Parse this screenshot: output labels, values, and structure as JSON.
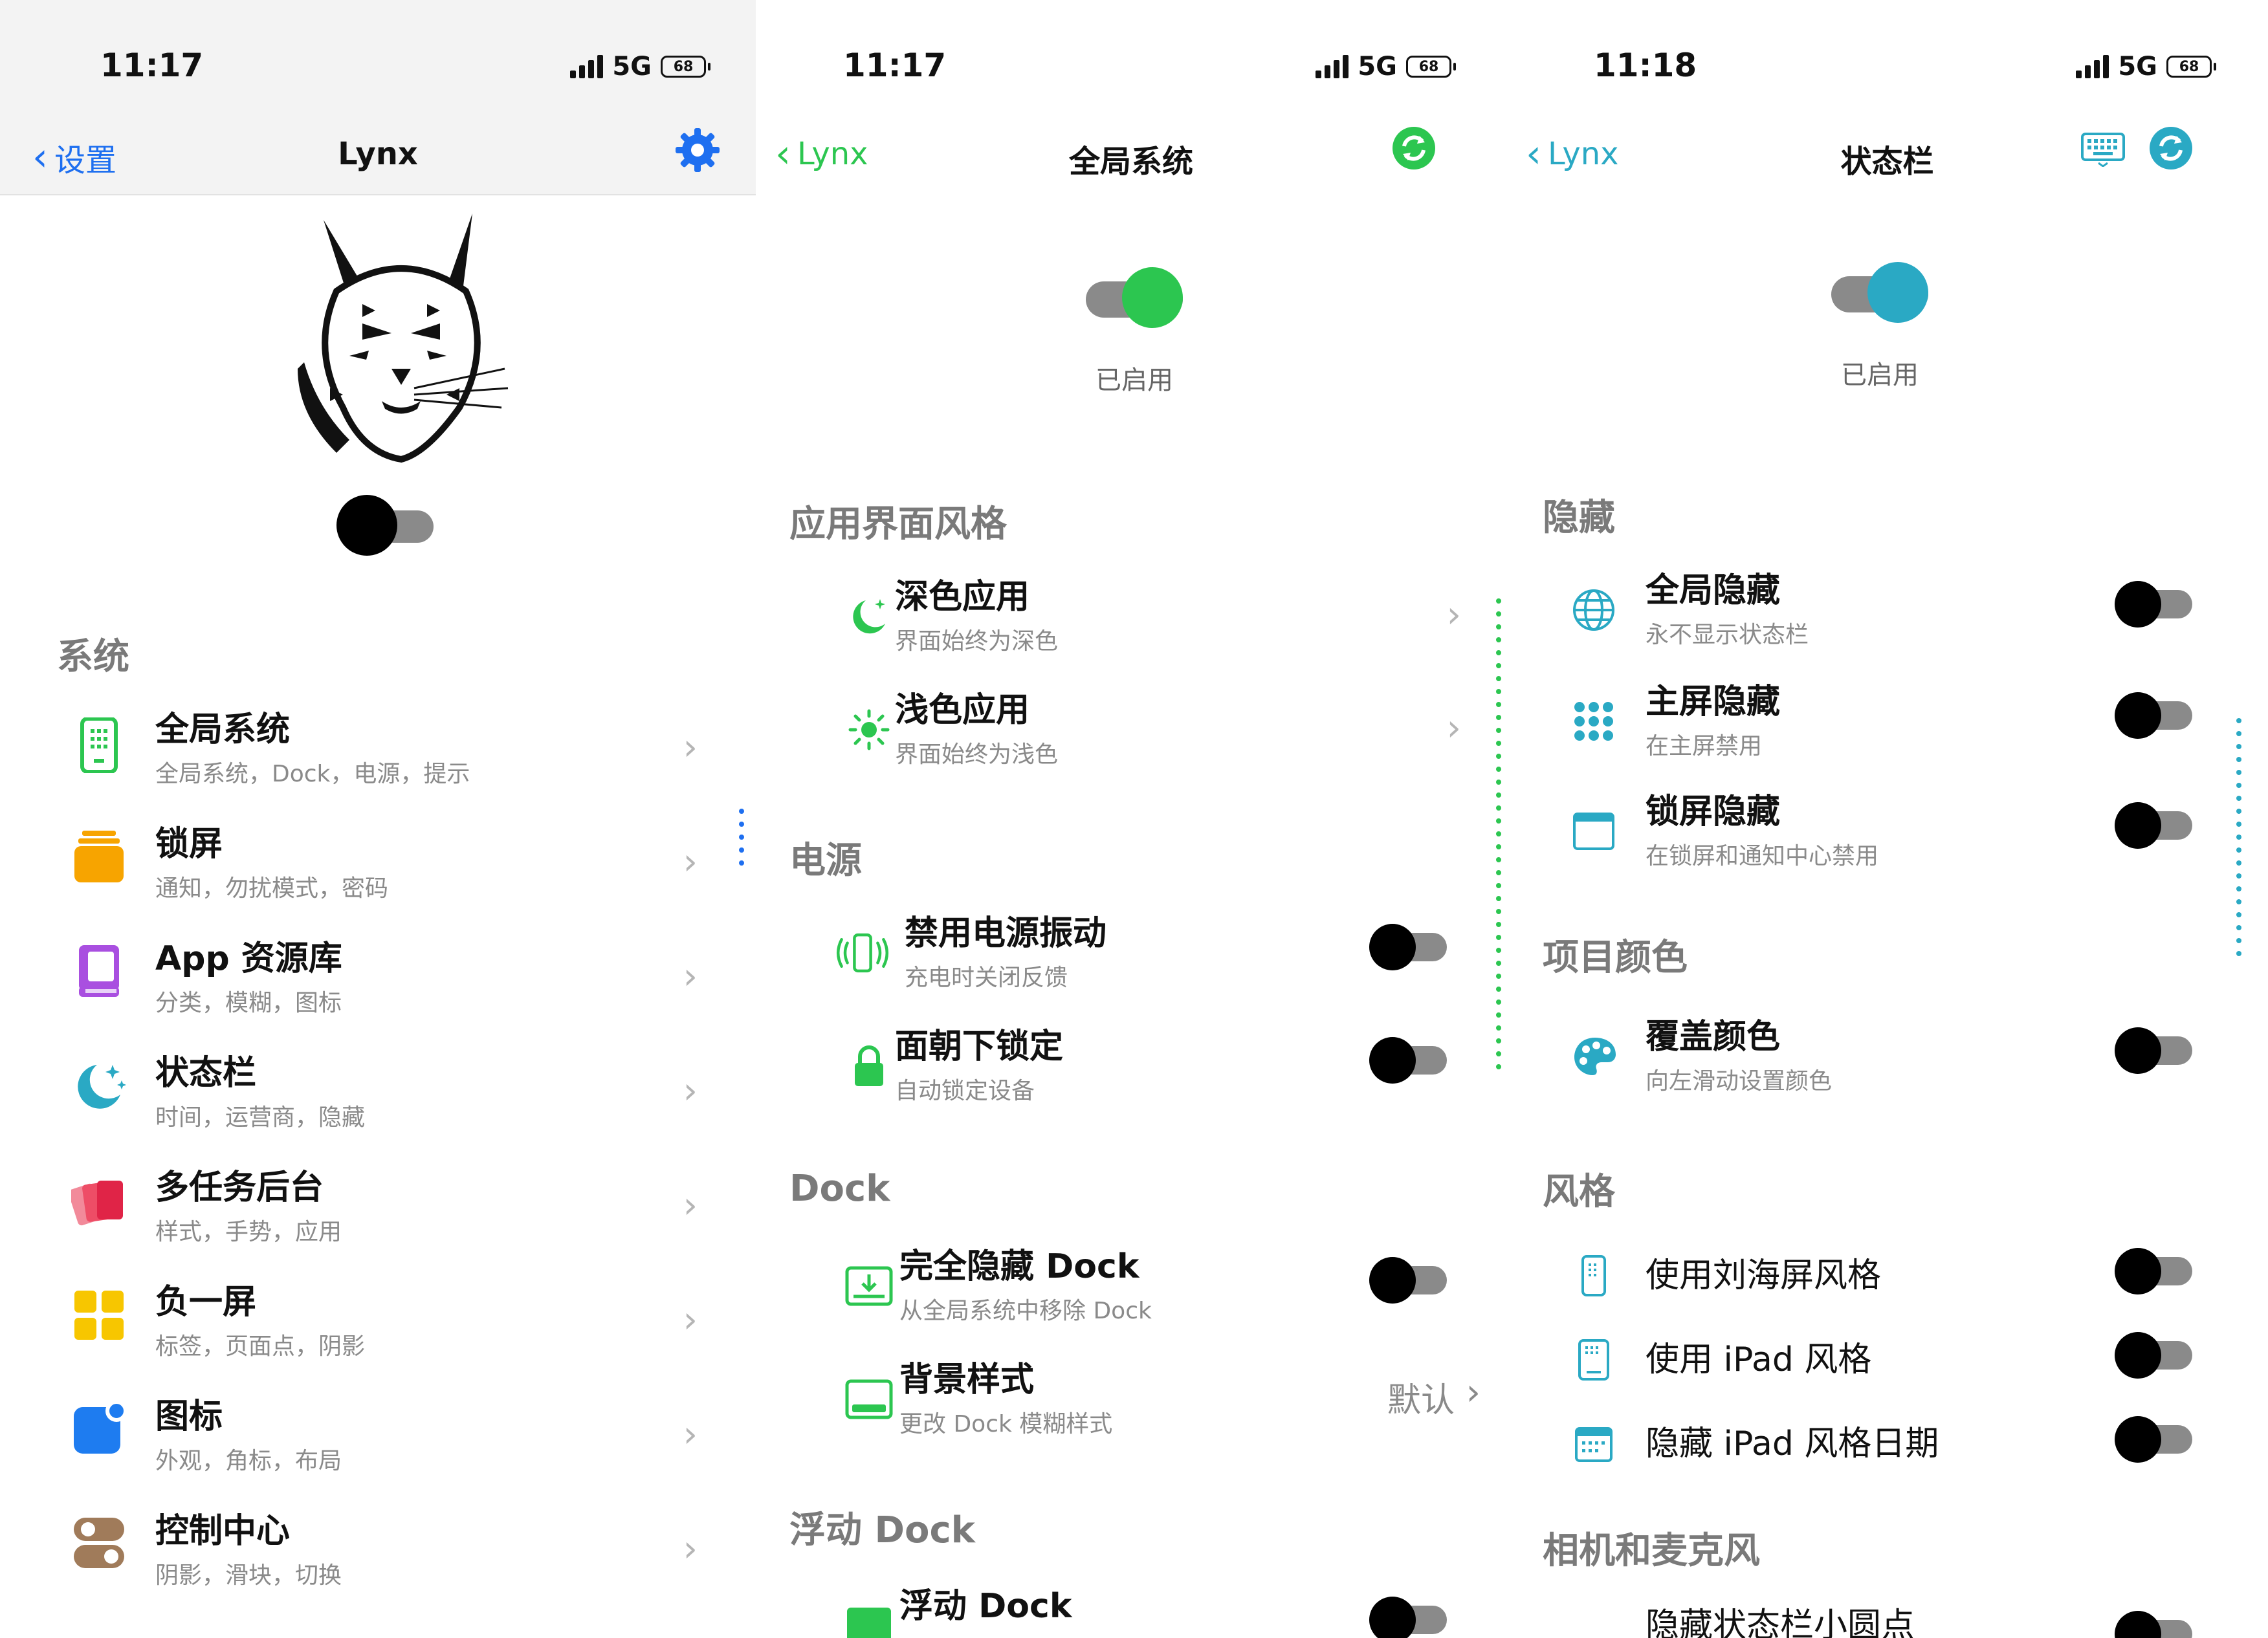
{
  "panels": [
    {
      "time": "11:17",
      "network": "5G",
      "battery": "68",
      "back_label": "设置",
      "title": "Lynx",
      "section": "系统",
      "items": [
        {
          "title": "全局系统",
          "sub": "全局系统，Dock，电源，提示"
        },
        {
          "title": "锁屏",
          "sub": "通知，勿扰模式，密码"
        },
        {
          "title": "App 资源库",
          "sub": "分类，模糊，图标"
        },
        {
          "title": "状态栏",
          "sub": "时间，运营商，隐藏"
        },
        {
          "title": "多任务后台",
          "sub": "样式，手势，应用"
        },
        {
          "title": "负一屏",
          "sub": "标签，页面点，阴影"
        },
        {
          "title": "图标",
          "sub": "外观，角标，布局"
        },
        {
          "title": "控制中心",
          "sub": "阴影，滑块，切换"
        }
      ]
    },
    {
      "time": "11:17",
      "network": "5G",
      "battery": "68",
      "back_label": "Lynx",
      "title": "全局系统",
      "enabled": "已启用",
      "sections": [
        {
          "label": "应用界面风格",
          "items": [
            {
              "title": "深色应用",
              "sub": "界面始终为深色"
            },
            {
              "title": "浅色应用",
              "sub": "界面始终为浅色"
            }
          ]
        },
        {
          "label": "电源",
          "items": [
            {
              "title": "禁用电源振动",
              "sub": "充电时关闭反馈"
            },
            {
              "title": "面朝下锁定",
              "sub": "自动锁定设备"
            }
          ]
        },
        {
          "label": "Dock",
          "items": [
            {
              "title": "完全隐藏 Dock",
              "sub": "从全局系统中移除 Dock"
            },
            {
              "title": "背景样式",
              "sub": "更改 Dock 模糊样式",
              "value": "默认"
            }
          ]
        },
        {
          "label": "浮动 Dock",
          "items": [
            {
              "title": "浮动 Dock",
              "sub": ""
            }
          ]
        }
      ]
    },
    {
      "time": "11:18",
      "network": "5G",
      "battery": "68",
      "back_label": "Lynx",
      "title": "状态栏",
      "enabled": "已启用",
      "sections": [
        {
          "label": "隐藏",
          "items": [
            {
              "title": "全局隐藏",
              "sub": "永不显示状态栏"
            },
            {
              "title": "主屏隐藏",
              "sub": "在主屏禁用"
            },
            {
              "title": "锁屏隐藏",
              "sub": "在锁屏和通知中心禁用"
            }
          ]
        },
        {
          "label": "项目颜色",
          "items": [
            {
              "title": "覆盖颜色",
              "sub": "向左滑动设置颜色"
            }
          ]
        },
        {
          "label": "风格",
          "items": [
            {
              "title": "使用刘海屏风格"
            },
            {
              "title": "使用 iPad 风格"
            },
            {
              "title": "隐藏 iPad 风格日期"
            }
          ]
        },
        {
          "label": "相机和麦克风",
          "items": [
            {
              "title": "隐藏状态栏小圆点"
            }
          ]
        }
      ]
    }
  ],
  "colors": {
    "ios_blue": "#1e6ff0",
    "green": "#2cc650",
    "teal": "#2aa9c4",
    "grey_text": "#8a8a8a"
  }
}
